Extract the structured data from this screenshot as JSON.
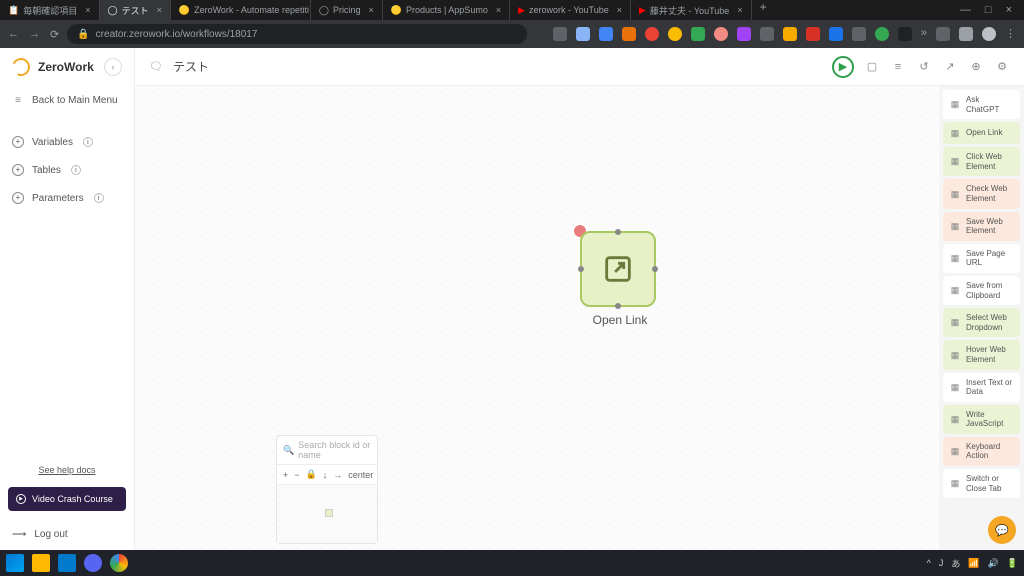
{
  "browser": {
    "tabs": [
      {
        "label": "毎朝確認項目"
      },
      {
        "label": "テスト"
      },
      {
        "label": "ZeroWork - Automate repetiti…"
      },
      {
        "label": "Pricing"
      },
      {
        "label": "Products | AppSumo"
      },
      {
        "label": "zerowork - YouTube"
      },
      {
        "label": "藤井丈夫 - YouTube"
      }
    ],
    "url": "creator.zerowork.io/workflows/18017"
  },
  "sidebar": {
    "brand": "ZeroWork",
    "back": "Back to Main Menu",
    "items": [
      {
        "label": "Variables"
      },
      {
        "label": "Tables"
      },
      {
        "label": "Parameters"
      }
    ],
    "help": "See help docs",
    "video": "Video Crash Course",
    "logout": "Log out"
  },
  "workflow": {
    "title": "テスト",
    "node_label": "Open Link"
  },
  "minimap": {
    "search_placeholder": "Search block id or name",
    "center": "center"
  },
  "actions": [
    {
      "label": "Ask ChatGPT",
      "hl": ""
    },
    {
      "label": "Open Link",
      "hl": "hl-green"
    },
    {
      "label": "Click Web Element",
      "hl": "hl-green"
    },
    {
      "label": "Check Web Element",
      "hl": "hl-peach"
    },
    {
      "label": "Save Web Element",
      "hl": "hl-peach"
    },
    {
      "label": "Save Page URL",
      "hl": ""
    },
    {
      "label": "Save from Clipboard",
      "hl": ""
    },
    {
      "label": "Select Web Dropdown",
      "hl": "hl-green"
    },
    {
      "label": "Hover Web Element",
      "hl": "hl-green"
    },
    {
      "label": "Insert Text or Data",
      "hl": ""
    },
    {
      "label": "Write JavaScript",
      "hl": "hl-green"
    },
    {
      "label": "Keyboard Action",
      "hl": "hl-peach"
    },
    {
      "label": "Switch or Close Tab",
      "hl": ""
    }
  ]
}
